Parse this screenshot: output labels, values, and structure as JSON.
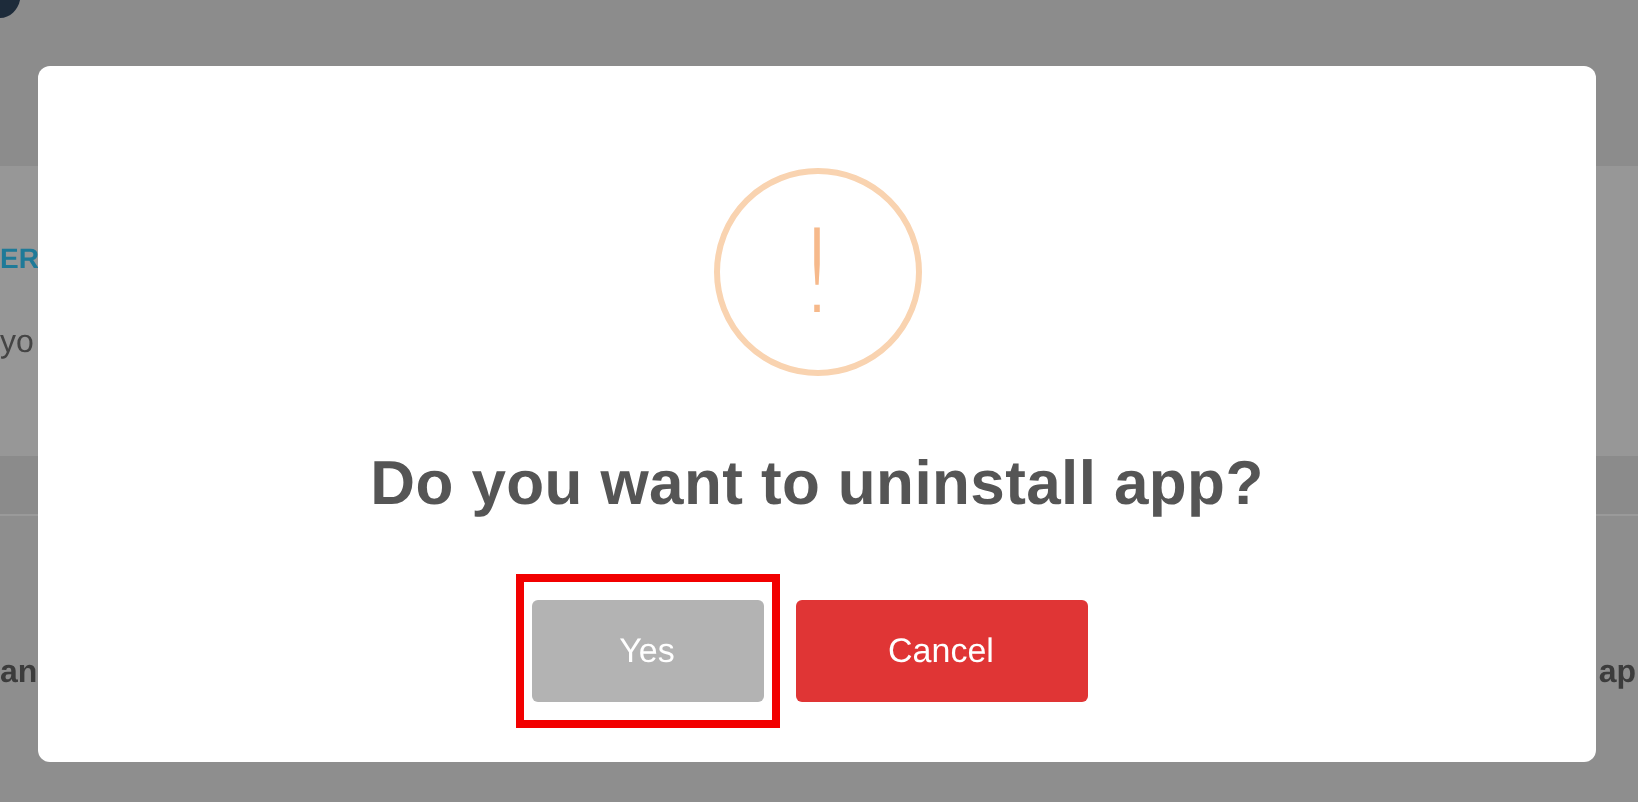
{
  "background_page": {
    "heading_fragment": "ER",
    "text_fragment": "yo",
    "row_left_fragment": "an",
    "row_right_fragment": "ap"
  },
  "dialog": {
    "icon": "!",
    "message": "Do you want to uninstall app?",
    "buttons": [
      {
        "label": "Yes",
        "kind": "confirm",
        "focused": true
      },
      {
        "label": "Cancel",
        "kind": "cancel",
        "focused": false
      }
    ]
  }
}
